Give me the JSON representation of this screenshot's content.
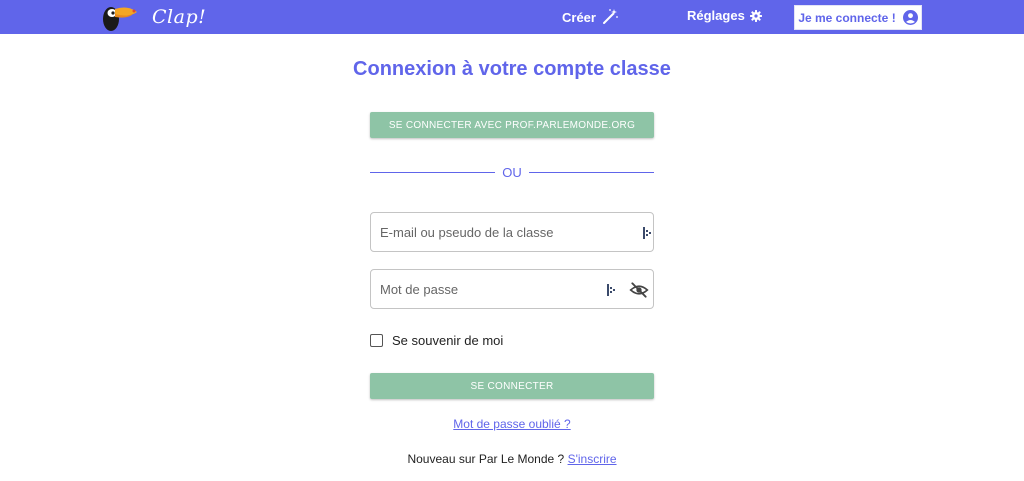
{
  "header": {
    "logo_text": "Clap!",
    "create_label": "Créer",
    "settings_label": "Réglages",
    "login_label": "Je me connecte !"
  },
  "main": {
    "title": "Connexion à votre compte classe",
    "sso_button": "SE CONNECTER AVEC PROF.PARLEMONDE.ORG",
    "divider_text": "OU",
    "email_placeholder": "E-mail ou pseudo de la classe",
    "password_placeholder": "Mot de passe",
    "remember_label": "Se souvenir de moi",
    "submit_button": "SE CONNECTER",
    "forgot_link": "Mot de passe oublié ?",
    "signup_text": "Nouveau sur Par Le Monde ?",
    "signup_link": "S'inscrire"
  },
  "colors": {
    "primary": "#6065ea",
    "button_green": "#8ec4a6",
    "white": "#ffffff"
  },
  "icons": [
    "toucan-logo",
    "magic-wand-icon",
    "gear-icon",
    "user-circle-icon",
    "password-manager-icon",
    "eye-off-icon"
  ]
}
